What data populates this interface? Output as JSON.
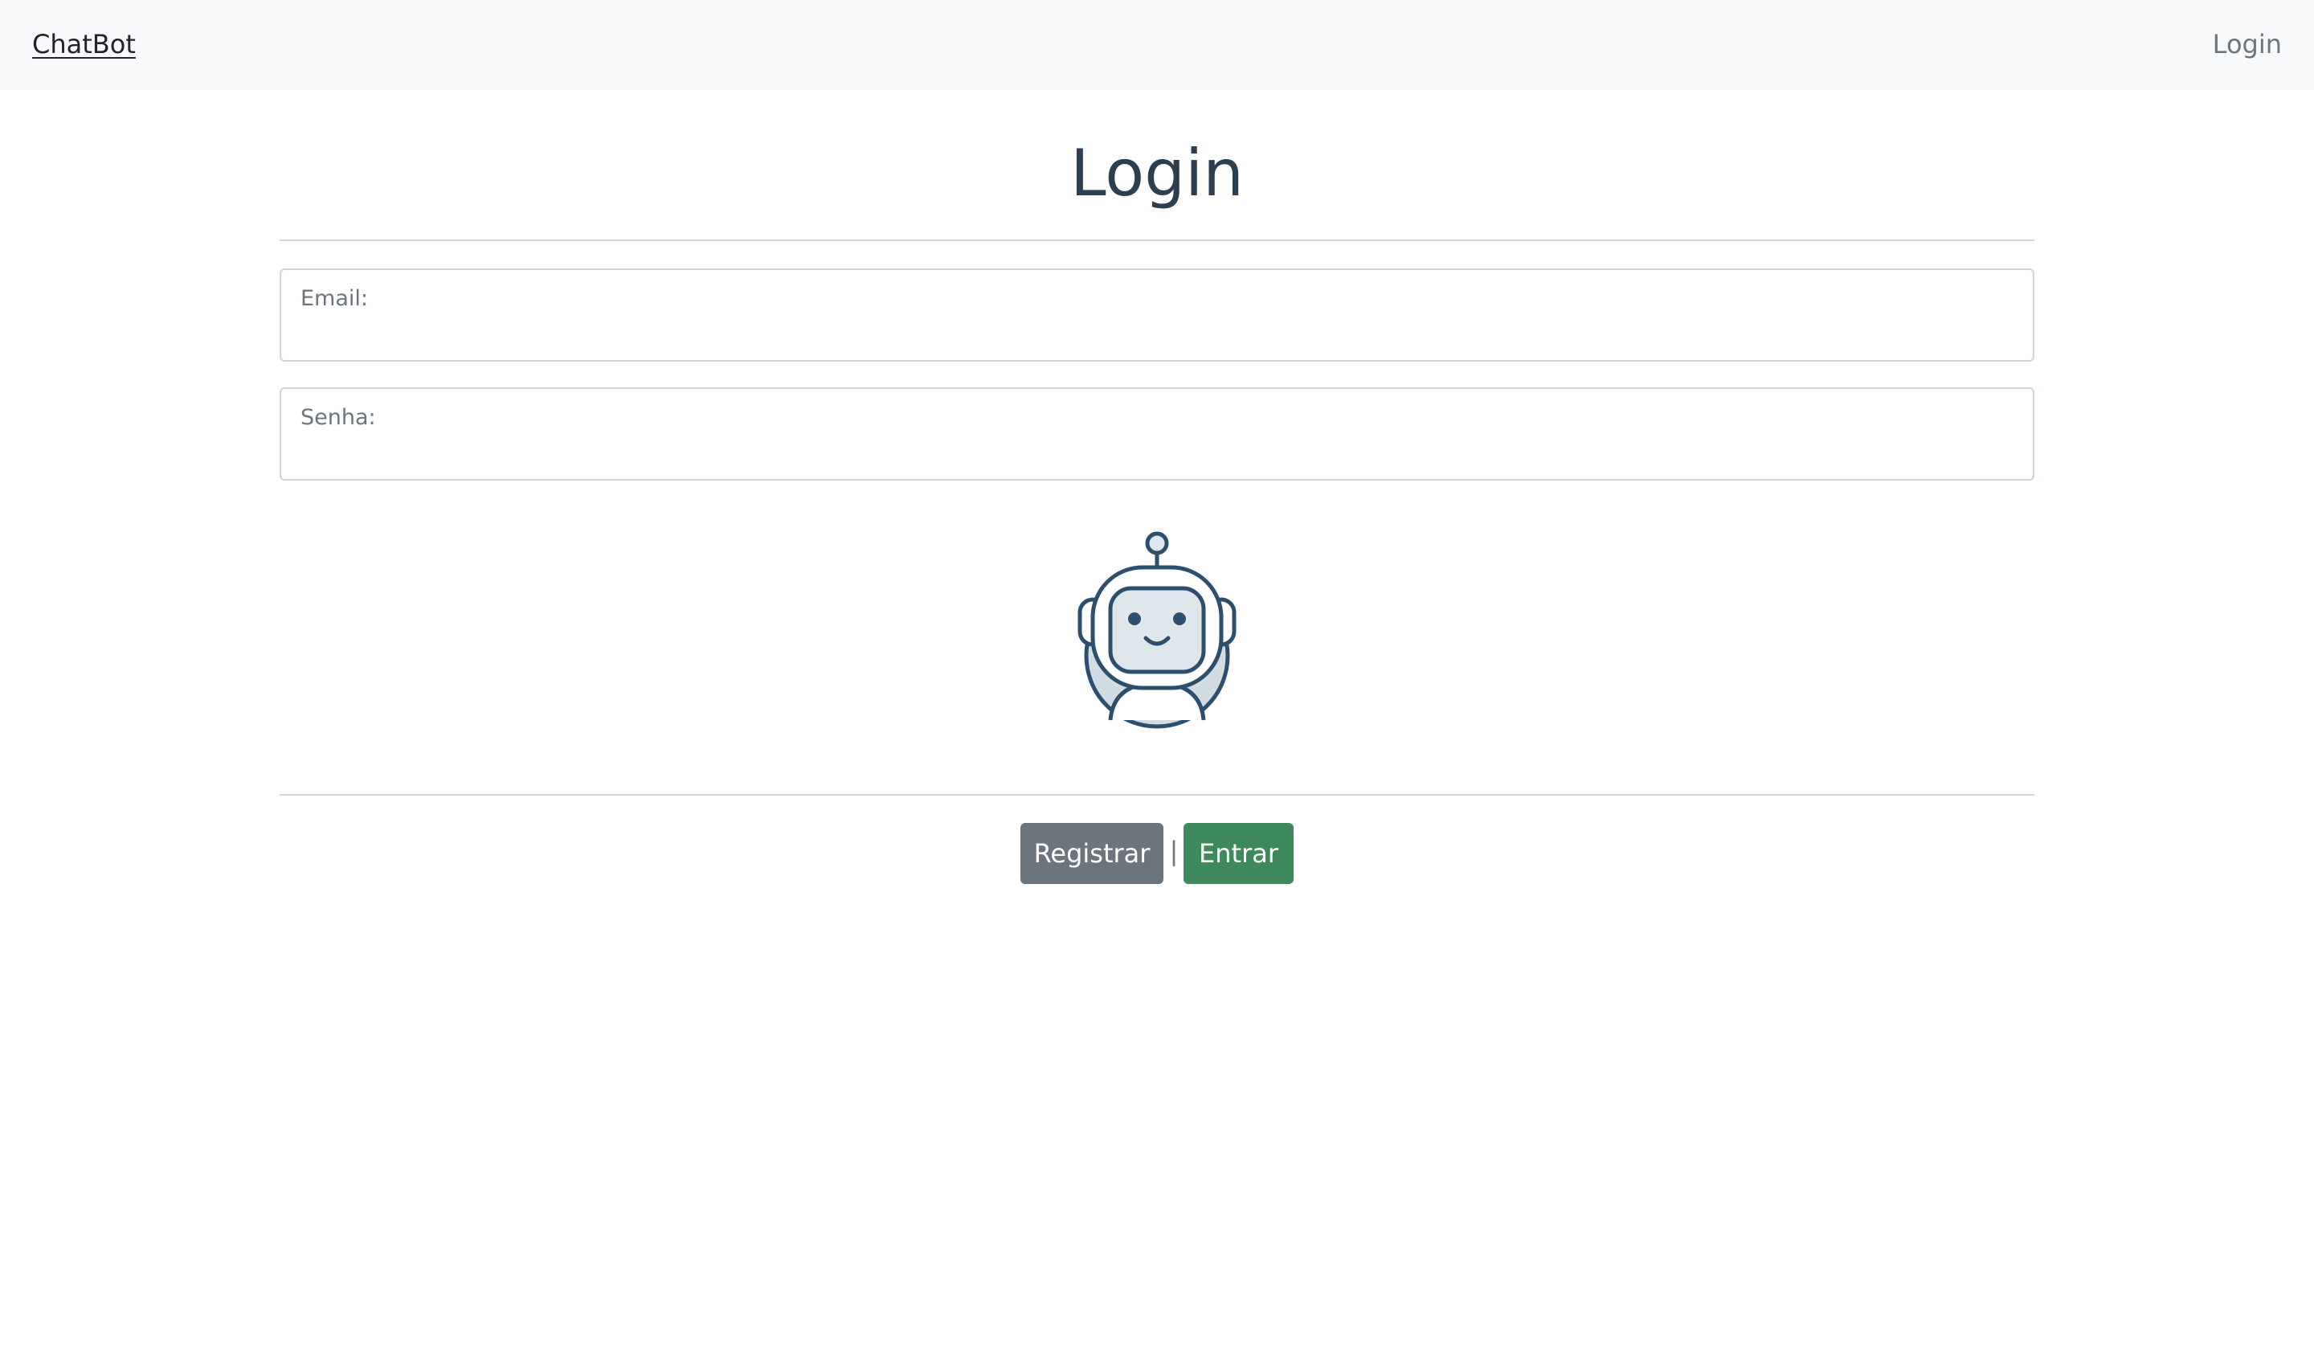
{
  "navbar": {
    "brand": "ChatBot",
    "login_link": "Login"
  },
  "page": {
    "title": "Login"
  },
  "form": {
    "email_label": "Email:",
    "email_value": "",
    "password_label": "Senha:",
    "password_value": ""
  },
  "illustration": {
    "icon": "robot-icon"
  },
  "actions": {
    "register_label": "Registrar",
    "separator": "|",
    "submit_label": "Entrar"
  },
  "colors": {
    "navbar_bg": "#f8f9fa",
    "title": "#2c3e50",
    "register_button": "#6c757d",
    "submit_button": "#3e8a5c",
    "robot_stroke": "#2c4f6e",
    "robot_fill": "#dde7ec"
  }
}
